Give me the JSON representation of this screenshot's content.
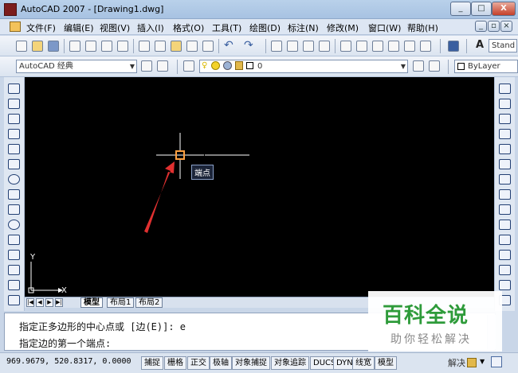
{
  "window": {
    "title": "AutoCAD 2007 - [Drawing1.dwg]",
    "minimize": "_",
    "maximize": "□",
    "close": "X"
  },
  "menu": [
    {
      "label": "文件(F)"
    },
    {
      "label": "编辑(E)"
    },
    {
      "label": "视图(V)"
    },
    {
      "label": "插入(I)"
    },
    {
      "label": "格式(O)"
    },
    {
      "label": "工具(T)"
    },
    {
      "label": "绘图(D)"
    },
    {
      "label": "标注(N)"
    },
    {
      "label": "修改(M)"
    },
    {
      "label": "窗口(W)"
    },
    {
      "label": "帮助(H)"
    }
  ],
  "toolbar": {
    "text_style": "Stand"
  },
  "workspace": {
    "value": "AutoCAD 经典"
  },
  "layer": {
    "value": "0"
  },
  "linetype": {
    "value": "ByLayer"
  },
  "canvas": {
    "snap_tooltip": "端点",
    "ucs_x": "X",
    "ucs_y": "Y"
  },
  "tabs": [
    {
      "label": "模型"
    },
    {
      "label": "布局1"
    },
    {
      "label": "布局2"
    }
  ],
  "command": {
    "history": "指定正多边形的中心点或 [边(E)]: e",
    "prompt": "指定边的第一个端点:"
  },
  "status": {
    "coords": "969.9679,  520.8317, 0.0000",
    "toggles": [
      {
        "label": "捕捉"
      },
      {
        "label": "栅格"
      },
      {
        "label": "正交"
      },
      {
        "label": "极轴"
      },
      {
        "label": "对象捕捉"
      },
      {
        "label": "对象追踪"
      },
      {
        "label": "DUCS"
      },
      {
        "label": "DYN"
      },
      {
        "label": "线宽"
      },
      {
        "label": "模型"
      }
    ],
    "unlock": "解决"
  },
  "watermark": {
    "logo": "百科全说",
    "sub": "助你轻松解决"
  },
  "colors": {
    "canvas": "#000000",
    "crosshair": "#ffffff",
    "snap_marker": "#ffa040",
    "arrow": "#e03030",
    "watermark": "#2e9b3a"
  }
}
